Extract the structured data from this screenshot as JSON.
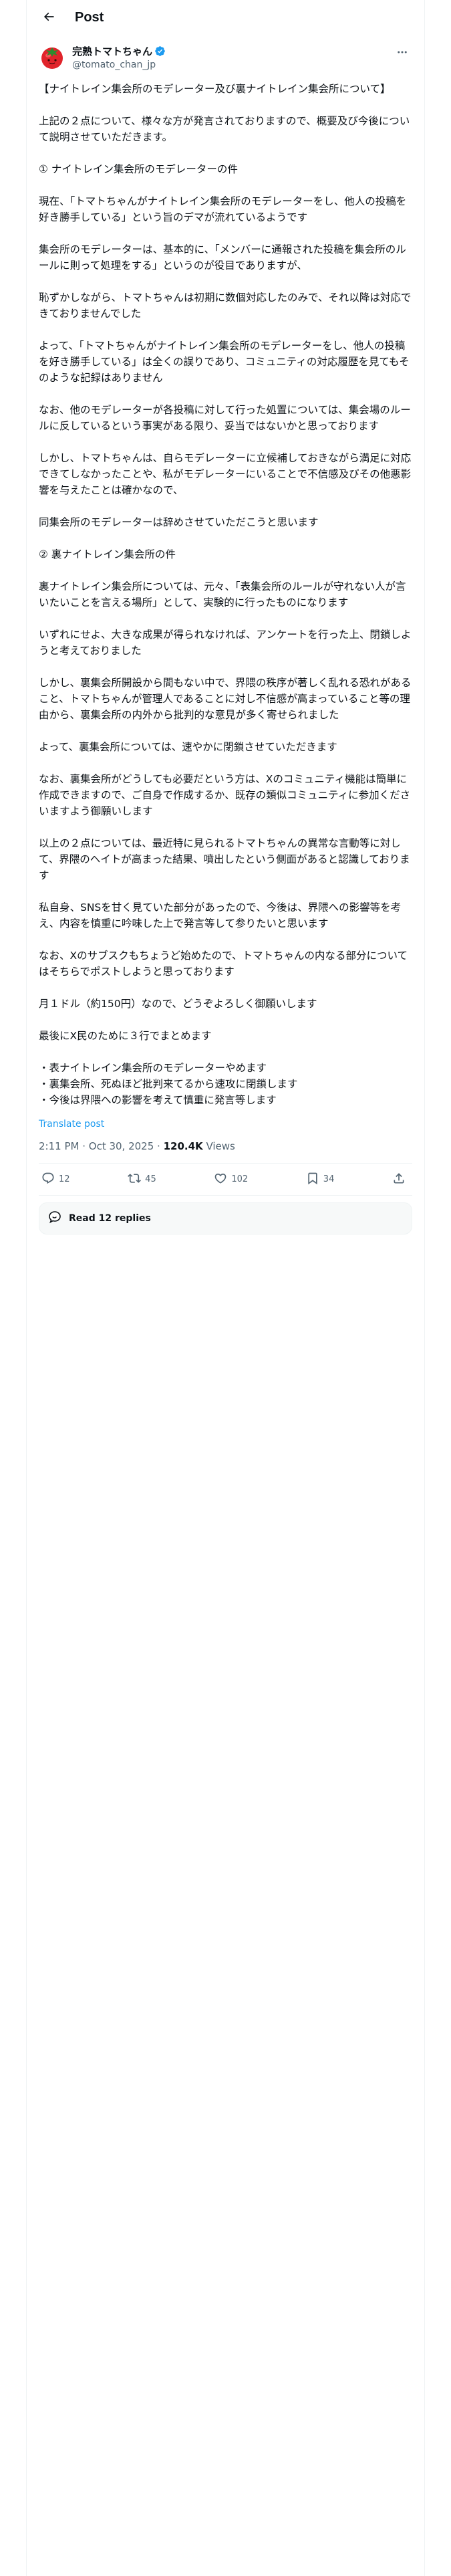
{
  "header": {
    "title": "Post"
  },
  "author": {
    "display_name": "完熟トマトちゃん",
    "handle": "@tomato_chan_jp"
  },
  "post": {
    "paragraphs": [
      "【ナイトレイン集会所のモデレーター及び裏ナイトレイン集会所について】",
      "上記の２点について、様々な方が発言されておりますので、概要及び今後について説明させていただきます。",
      "① ナイトレイン集会所のモデレーターの件",
      "現在、「トマトちゃんがナイトレイン集会所のモデレーターをし、他人の投稿を好き勝手している」という旨のデマが流れているようです",
      "集会所のモデレーターは、基本的に、「メンバーに通報された投稿を集会所のルールに則って処理をする」というのが役目でありますが、",
      "恥ずかしながら、トマトちゃんは初期に数個対応したのみで、それ以降は対応できておりませんでした",
      "よって、「トマトちゃんがナイトレイン集会所のモデレーターをし、他人の投稿を好き勝手している」は全くの誤りであり、コミュニティの対応履歴を見てもそのような記録はありません",
      "なお、他のモデレーターが各投稿に対して行った処置については、集会場のルールに反しているという事実がある限り、妥当ではないかと思っております",
      "しかし、トマトちゃんは、自らモデレーターに立候補しておきながら満足に対応できてしなかったことや、私がモデレーターにいることで不信感及びその他悪影響を与えたことは確かなので、",
      "同集会所のモデレーターは辞めさせていただこうと思います",
      "② 裏ナイトレイン集会所の件",
      "裏ナイトレイン集会所については、元々、「表集会所のルールが守れない人が言いたいことを言える場所」として、実験的に行ったものになります",
      "いずれにせよ、大きな成果が得られなければ、アンケートを行った上、閉鎖しようと考えておりました",
      "しかし、裏集会所開設から間もない中で、界隈の秩序が著しく乱れる恐れがあること、トマトちゃんが管理人であることに対し不信感が高まっていること等の理由から、裏集会所の内外から批判的な意見が多く寄せられました",
      "よって、裏集会所については、速やかに閉鎖させていただきます",
      "なお、裏集会所がどうしても必要だという方は、Xのコミュニティ機能は簡単に作成できますので、ご自身で作成するか、既存の類似コミュニティに参加くださいますよう御願いします",
      "以上の２点については、最近特に見られるトマトちゃんの異常な言動等に対して、界隈のヘイトが高まった結果、噴出したという側面があると認識しております",
      "私自身、SNSを甘く見ていた部分があったので、今後は、界隈への影響等を考え、内容を慎重に吟味した上で発言等して参りたいと思います",
      "なお、Xのサブスクもちょうど始めたので、トマトちゃんの内なる部分についてはそちらでポストしようと思っております",
      "月１ドル（約150円）なので、どうぞよろしく御願いします",
      "最後にX民のために３行でまとめます",
      "・表ナイトレイン集会所のモデレーターやめます\n・裏集会所、死ぬほど批判来てるから速攻に閉鎖します\n・今後は界隈への影響を考えて慎重に発言等します"
    ],
    "translate_label": "Translate post",
    "time": "2:11 PM",
    "date": "Oct 30, 2025",
    "views_count": "120.4K",
    "views_label": "Views",
    "sep": " · "
  },
  "actions": {
    "replies": "12",
    "reposts": "45",
    "likes": "102",
    "bookmarks": "34"
  },
  "replies_bar": {
    "label": "Read 12 replies"
  },
  "colors": {
    "accent": "#1d9bf0",
    "muted": "#536471",
    "text": "#0f1419",
    "avatar_red": "#e0242b"
  },
  "icons": {
    "back": "arrow-left-icon",
    "more": "more-horizontal-icon",
    "verified": "verified-badge-icon",
    "reply": "reply-icon",
    "repost": "repost-icon",
    "like": "heart-icon",
    "bookmark": "bookmark-icon",
    "share": "share-icon",
    "replies_bubble": "speech-bubble-icon"
  }
}
